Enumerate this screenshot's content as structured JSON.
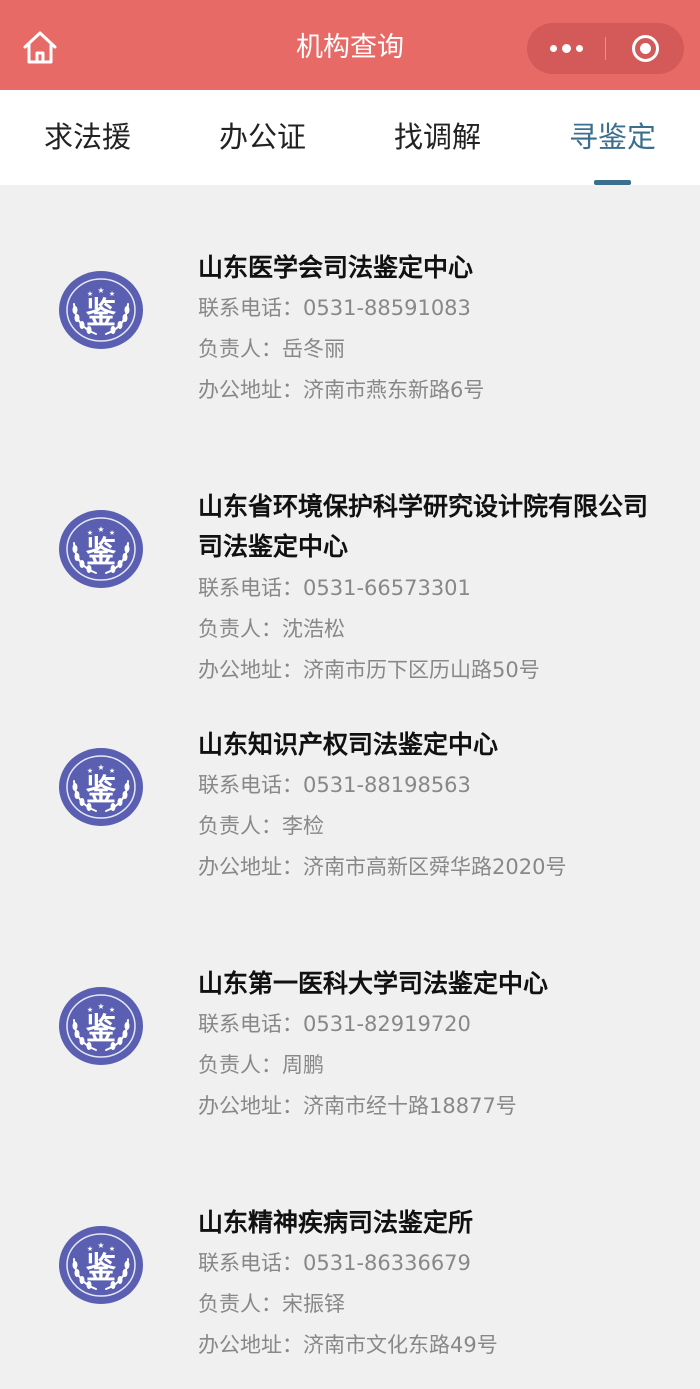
{
  "header": {
    "title": "机构查询",
    "icons": {
      "home": "home-icon",
      "more": "more-dots-icon",
      "close": "close-circle-icon"
    },
    "color": "#e86a67"
  },
  "tabs": [
    {
      "label": "求法援"
    },
    {
      "label": "办公证"
    },
    {
      "label": "找调解"
    },
    {
      "label": "寻鉴定",
      "active": true
    }
  ],
  "accent_color": "#3b6f8e",
  "logo_glyph": "鉴",
  "institutions": [
    {
      "name": "山东医学会司法鉴定中心",
      "phone_label": "联系电话：",
      "phone": "0531-88591083",
      "head_label": "负责人：",
      "head": "岳冬丽",
      "addr_label": "办公地址：",
      "addr": "济南市燕东新路6号"
    },
    {
      "name": "山东省环境保护科学研究设计院有限公司司法鉴定中心",
      "phone_label": "联系电话：",
      "phone": "0531-66573301",
      "head_label": "负责人：",
      "head": "沈浩松",
      "addr_label": "办公地址：",
      "addr": "济南市历下区历山路50号"
    },
    {
      "name": "山东知识产权司法鉴定中心",
      "phone_label": "联系电话：",
      "phone": "0531-88198563",
      "head_label": "负责人：",
      "head": "李检",
      "addr_label": "办公地址：",
      "addr": "济南市高新区舜华路2020号"
    },
    {
      "name": "山东第一医科大学司法鉴定中心",
      "phone_label": "联系电话：",
      "phone": "0531-82919720",
      "head_label": "负责人：",
      "head": "周鹏",
      "addr_label": "办公地址：",
      "addr": "济南市经十路18877号"
    },
    {
      "name": "山东精神疾病司法鉴定所",
      "phone_label": "联系电话：",
      "phone": "0531-86336679",
      "head_label": "负责人：",
      "head": "宋振铎",
      "addr_label": "办公地址：",
      "addr": "济南市文化东路49号"
    }
  ]
}
